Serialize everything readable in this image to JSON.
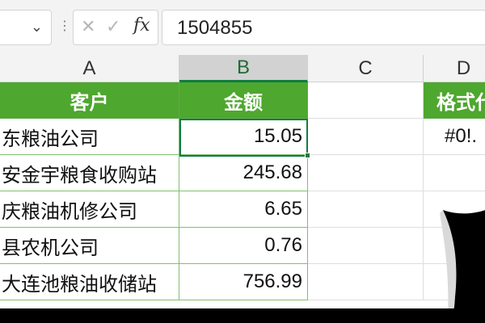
{
  "formula_bar": {
    "fx_label": "fx",
    "cancel_icon": "close-icon",
    "enter_icon": "checkmark-icon",
    "value": "1504855"
  },
  "columns": [
    {
      "label": "A",
      "selected": false
    },
    {
      "label": "B",
      "selected": true
    },
    {
      "label": "C",
      "selected": false
    },
    {
      "label": "D",
      "selected": false
    }
  ],
  "table": {
    "headers": [
      "客户",
      "金额"
    ],
    "rows": [
      {
        "customer": "东粮油公司",
        "amount": "15.05"
      },
      {
        "customer": "安金宇粮食收购站",
        "amount": "245.68"
      },
      {
        "customer": "庆粮油机修公司",
        "amount": "6.65"
      },
      {
        "customer": "县农机公司",
        "amount": "0.76"
      },
      {
        "customer": "大连池粮油收储站",
        "amount": "756.99"
      }
    ]
  },
  "column_d": {
    "header": "格式代",
    "value": "#0!."
  },
  "colors": {
    "header_green": "#4ea72e",
    "selection_green": "#107c41"
  }
}
